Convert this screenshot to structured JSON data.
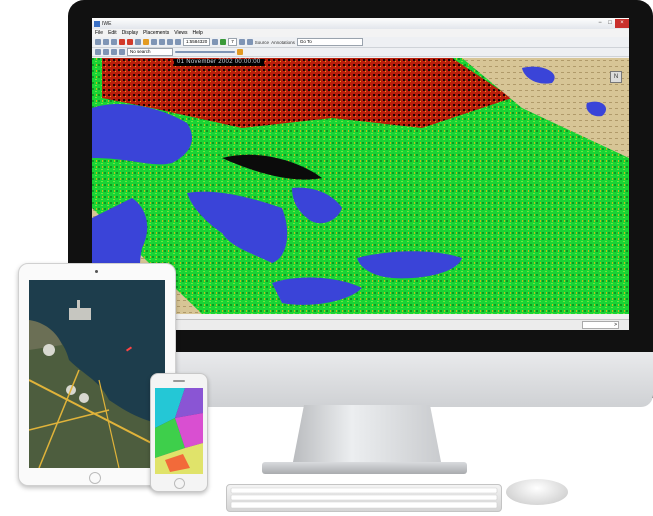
{
  "app": {
    "title": "IWE",
    "menu": [
      "File",
      "Edit",
      "Display",
      "Placements",
      "Views",
      "Help"
    ],
    "toolbar": {
      "scale": "1:5584320",
      "frame_count": "7",
      "search_placeholder": "No search",
      "source_label": "Source",
      "annotations_label": "Annotations",
      "goto_label": "Go To"
    },
    "map": {
      "timestamp": "01 November 2002 00:00:00",
      "compass_label": "N",
      "colors": {
        "water": "#3a44d8",
        "high_vegetation": "#19e03a",
        "low_vegetation": "#cf2a12",
        "bare_land": "#d9c89b"
      }
    },
    "status": {
      "field_value": ">"
    },
    "window_buttons": [
      "−",
      "□",
      "×"
    ]
  },
  "devices": {
    "ipad": "satellite-harbor-map",
    "iphone": "colored-field-map"
  }
}
